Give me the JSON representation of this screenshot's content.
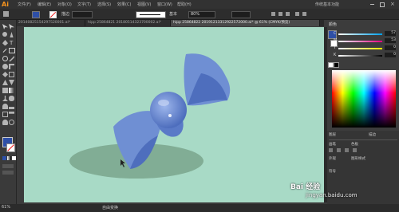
{
  "app": {
    "logo": "Ai"
  },
  "menu": [
    "文件(F)",
    "编辑(E)",
    "对象(O)",
    "文字(T)",
    "选择(S)",
    "效果(C)",
    "视图(V)",
    "窗口(W)",
    "帮助(H)"
  ],
  "workspace": "传统基本功能",
  "control": {
    "stroke_label": "描边",
    "style_label": "基本",
    "opacity": "80%"
  },
  "tabs": [
    {
      "label": "20140825154297520001.ai*",
      "active": false
    },
    {
      "label": "hipp 25864821 20180514323700002.ai*",
      "active": false
    },
    {
      "label": "hipp 25864822 20191213312922572000.ai* @ 61% (CMYK/预览)",
      "active": true
    }
  ],
  "zoom": "61%",
  "status_text": "自由变换",
  "panel": {
    "color_tab": "颜色",
    "channels": [
      {
        "label": "C",
        "value": "57"
      },
      {
        "label": "M",
        "value": "53"
      },
      {
        "label": "Y",
        "value": "0"
      },
      {
        "label": "K",
        "value": "0"
      }
    ],
    "sections": [
      "图层",
      "画笔",
      "色板",
      "描边",
      "外观",
      "图形样式",
      "符号"
    ]
  },
  "colors": {
    "canvas": "#a8dac6",
    "bow_light": "#6f8fd3",
    "bow_dark": "#4e6ebd",
    "shadow": "#7aa58c",
    "fill_swatch": "#2e4fa7"
  },
  "watermark": {
    "text": "Bai 经验",
    "url": "jingyan.baidu.com"
  }
}
